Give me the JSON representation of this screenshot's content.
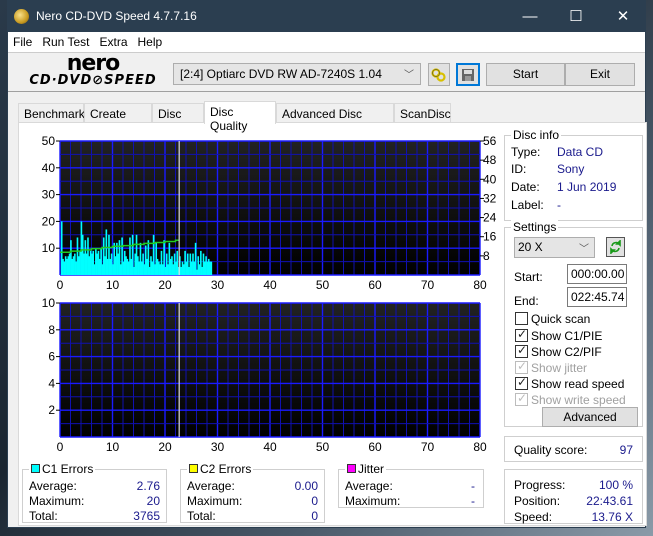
{
  "window": {
    "title": "Nero CD-DVD Speed 4.7.7.16",
    "controls": {
      "minimize": "—",
      "maximize": "☐",
      "close": "✕"
    }
  },
  "menu": [
    "File",
    "Run Test",
    "Extra",
    "Help"
  ],
  "toolbar": {
    "logo_top": "nero",
    "logo_bottom": "CD·DVD⊘SPEED",
    "drive": "[2:4]  Optiarc DVD RW AD-7240S 1.04",
    "start_label": "Start",
    "exit_label": "Exit"
  },
  "tabs": [
    {
      "label": "Benchmark",
      "active": false
    },
    {
      "label": "Create Disc",
      "active": false
    },
    {
      "label": "Disc Info",
      "active": false
    },
    {
      "label": "Disc Quality",
      "active": true
    },
    {
      "label": "Advanced Disc Quality",
      "active": false
    },
    {
      "label": "ScanDisc",
      "active": false
    }
  ],
  "disc_info": {
    "title": "Disc info",
    "type_label": "Type:",
    "type": "Data CD",
    "id_label": "ID:",
    "id": "Sony",
    "date_label": "Date:",
    "date": "1 Jun 2019",
    "label_label": "Label:",
    "label": "-"
  },
  "settings": {
    "title": "Settings",
    "speed": "20 X",
    "start_label": "Start:",
    "start": "000:00.00",
    "end_label": "End:",
    "end": "022:45.74",
    "checkboxes": [
      {
        "label": "Quick scan",
        "checked": false,
        "disabled": false
      },
      {
        "label": "Show C1/PIE",
        "checked": true,
        "disabled": false
      },
      {
        "label": "Show C2/PIF",
        "checked": true,
        "disabled": false
      },
      {
        "label": "Show jitter",
        "checked": true,
        "disabled": true
      },
      {
        "label": "Show read speed",
        "checked": true,
        "disabled": false
      },
      {
        "label": "Show write speed",
        "checked": true,
        "disabled": true
      }
    ],
    "advanced_label": "Advanced"
  },
  "quality": {
    "label": "Quality score:",
    "value": "97"
  },
  "progress": {
    "progress_label": "Progress:",
    "progress": "100 %",
    "position_label": "Position:",
    "position": "22:43.61",
    "speed_label": "Speed:",
    "speed": "13.76 X"
  },
  "stats": {
    "c1": {
      "title": "C1 Errors",
      "color": "#00ffff",
      "average_label": "Average:",
      "average": "2.76",
      "maximum_label": "Maximum:",
      "maximum": "20",
      "total_label": "Total:",
      "total": "3765"
    },
    "c2": {
      "title": "C2 Errors",
      "color": "#ffff00",
      "average_label": "Average:",
      "average": "0.00",
      "maximum_label": "Maximum:",
      "maximum": "0",
      "total_label": "Total:",
      "total": "0"
    },
    "jitter": {
      "title": "Jitter",
      "color": "#ff00ff",
      "average_label": "Average:",
      "average": "-",
      "maximum_label": "Maximum:",
      "maximum": "-"
    }
  },
  "chart_data": [
    {
      "type": "bar",
      "title": "C1 Errors",
      "xlim": [
        0,
        80
      ],
      "ylim": [
        0,
        50
      ],
      "y2lim": [
        0,
        56
      ],
      "x_ticks": [
        0,
        10,
        20,
        30,
        40,
        50,
        60,
        70,
        80
      ],
      "y_ticks": [
        10,
        20,
        30,
        40,
        50
      ],
      "y2_ticks": [
        8,
        16,
        24,
        32,
        40,
        48,
        56
      ],
      "end_marker_x": 22.7,
      "grid": true,
      "series": [
        {
          "name": "C1",
          "color": "#00ffff",
          "x_start": 0.3,
          "x_step": 0.25,
          "values": [
            20,
            6,
            5,
            7,
            6,
            7,
            8,
            13,
            6,
            7,
            8,
            5,
            14,
            7,
            9,
            20,
            15,
            8,
            13,
            8,
            14,
            7,
            9,
            8,
            9,
            4,
            10,
            8,
            9,
            6,
            10,
            4,
            14,
            7,
            17,
            6,
            15,
            6,
            8,
            4,
            12,
            7,
            12,
            8,
            13,
            4,
            14,
            5,
            9,
            7,
            6,
            5,
            14,
            6,
            15,
            3,
            8,
            15,
            7,
            5,
            12,
            5,
            8,
            4,
            11,
            6,
            13,
            3,
            7,
            5,
            15,
            4,
            12,
            6,
            5,
            4,
            9,
            4,
            13,
            3,
            8,
            4,
            12,
            6,
            7,
            4,
            8,
            5,
            9,
            3,
            7,
            3,
            5,
            4,
            9,
            5,
            8,
            3,
            8,
            5,
            8,
            5,
            12,
            2,
            7,
            4,
            9,
            3,
            8,
            5,
            7,
            5,
            6,
            5,
            5
          ]
        },
        {
          "name": "Read speed",
          "color": "#22cc22",
          "axis": "right",
          "x": [
            0,
            2,
            4,
            6,
            8,
            10,
            12,
            14,
            16,
            18,
            20,
            22
          ],
          "values": [
            9.5,
            10,
            10.5,
            11,
            11.5,
            12,
            12.3,
            12.8,
            13.2,
            13.6,
            14.0,
            14.5
          ]
        }
      ]
    },
    {
      "type": "bar",
      "title": "C2 Errors",
      "xlim": [
        0,
        80
      ],
      "ylim": [
        0,
        10
      ],
      "x_ticks": [
        0,
        10,
        20,
        30,
        40,
        50,
        60,
        70,
        80
      ],
      "y_ticks": [
        2,
        4,
        6,
        8,
        10
      ],
      "end_marker_x": 22.7,
      "grid": true,
      "series": [
        {
          "name": "C2",
          "color": "#ffff00",
          "values": []
        }
      ]
    }
  ]
}
